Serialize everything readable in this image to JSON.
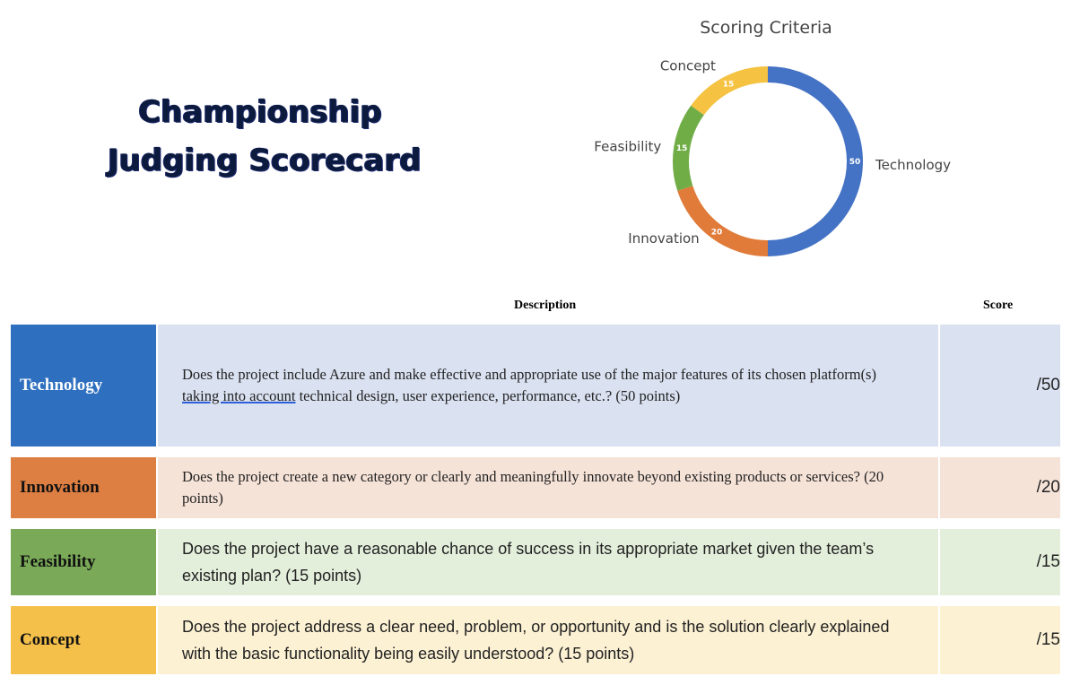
{
  "title": {
    "line1": "Championship",
    "line2": "Judging Scorecard"
  },
  "chart_data": {
    "type": "pie",
    "title": "Scoring Criteria",
    "categories": [
      "Technology",
      "Innovation",
      "Feasibility",
      "Concept"
    ],
    "values": [
      50,
      20,
      15,
      15
    ],
    "colors": [
      "#4472c4",
      "#e07b39",
      "#70ad47",
      "#f5c242"
    ],
    "legend": "none"
  },
  "table": {
    "headers": {
      "description": "Description",
      "score": "Score"
    },
    "rows": [
      {
        "category": "Technology",
        "desc_before": "Does the project include Azure and make effective and appropriate use of the major features of its chosen platform(s) ",
        "desc_link": "taking into account",
        "desc_after": " technical design, user experience, performance, etc.? (50 points)",
        "score": "/50",
        "cat_color": "#2f6fbf",
        "cat_text_color": "#ffffff",
        "row_color": "#dae1f1"
      },
      {
        "category": "Innovation",
        "description": "Does the project create a new category or clearly and meaningfully innovate beyond existing products or services? (20 points)",
        "score": "/20",
        "cat_color": "#dd7e42",
        "cat_text_color": "#111111",
        "row_color": "#f6e3d8"
      },
      {
        "category": "Feasibility",
        "description": "Does the project have a reasonable chance of success in its appropriate market given the team’s existing plan? (15 points)",
        "score": "/15",
        "cat_color": "#7aaa57",
        "cat_text_color": "#111111",
        "row_color": "#e3eedb"
      },
      {
        "category": "Concept",
        "description": "Does the project address a clear need, problem, or opportunity and is the solution clearly explained with the basic functionality being easily understood? (15 points)",
        "score": "/15",
        "cat_color": "#f4c04a",
        "cat_text_color": "#111111",
        "row_color": "#fcf1d3"
      }
    ]
  }
}
